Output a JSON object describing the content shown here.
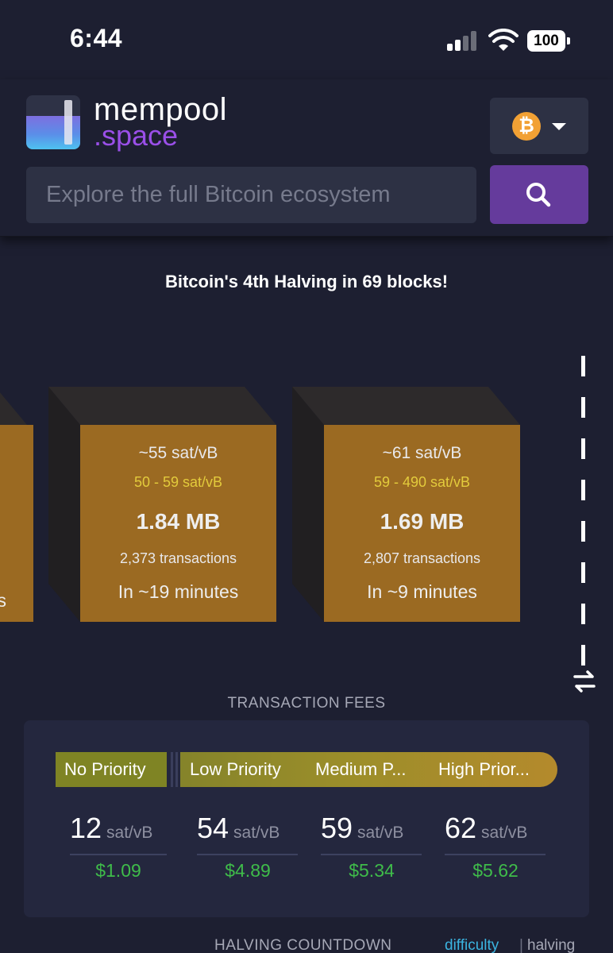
{
  "status": {
    "time": "6:44",
    "battery": "100"
  },
  "header": {
    "logo_line1": "mempool",
    "logo_line2": ".space",
    "network_icon": "bitcoin-icon",
    "search_placeholder": "Explore the full Bitcoin ecosystem"
  },
  "banner": "Bitcoin's 4th Halving in 69 blocks!",
  "blocks": [
    {
      "fee": "~55 sat/vB",
      "range": "50 - 59 sat/vB",
      "size": "1.84 MB",
      "tx": "2,373 transactions",
      "eta": "In ~19 minutes"
    },
    {
      "fee": "~61 sat/vB",
      "range": "59 - 490 sat/vB",
      "size": "1.69 MB",
      "tx": "2,807 transactions",
      "eta": "In ~9 minutes"
    }
  ],
  "fees": {
    "title": "TRANSACTION FEES",
    "priorities": [
      "No Priority",
      "Low Priority",
      "Medium P...",
      "High Prior..."
    ],
    "rates": [
      {
        "value": "12",
        "unit": "sat/vB",
        "usd": "$1.09"
      },
      {
        "value": "54",
        "unit": "sat/vB",
        "usd": "$4.89"
      },
      {
        "value": "59",
        "unit": "sat/vB",
        "usd": "$5.34"
      },
      {
        "value": "62",
        "unit": "sat/vB",
        "usd": "$5.62"
      }
    ]
  },
  "halving_section": {
    "title": "HALVING COUNTDOWN",
    "tab_difficulty": "difficulty",
    "tab_separator": "|",
    "tab_halving": "halving"
  },
  "colors": {
    "accent": "#653b9c",
    "block": "#9b6a22",
    "fee_usd": "#3fbc4a",
    "range": "#e3cb3c"
  }
}
